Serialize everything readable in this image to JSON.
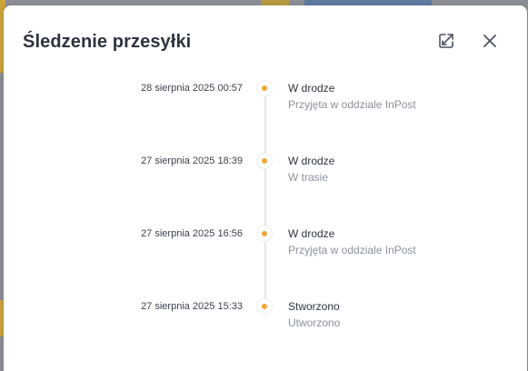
{
  "modal": {
    "title": "Śledzenie przesyłki",
    "accent_color": "#f0a535"
  },
  "icons": {
    "expand": "expand-icon",
    "close": "close-icon"
  },
  "events": [
    {
      "date": "28 sierpnia 2025 00:57",
      "status": "W drodze",
      "detail": "Przyjęta w oddziale InPost"
    },
    {
      "date": "27 sierpnia 2025 18:39",
      "status": "W drodze",
      "detail": "W trasie"
    },
    {
      "date": "27 sierpnia 2025 16:56",
      "status": "W drodze",
      "detail": "Przyjęta w oddziale InPost"
    },
    {
      "date": "27 sierpnia 2025 15:33",
      "status": "Stworzono",
      "detail": "Utworzono"
    }
  ]
}
